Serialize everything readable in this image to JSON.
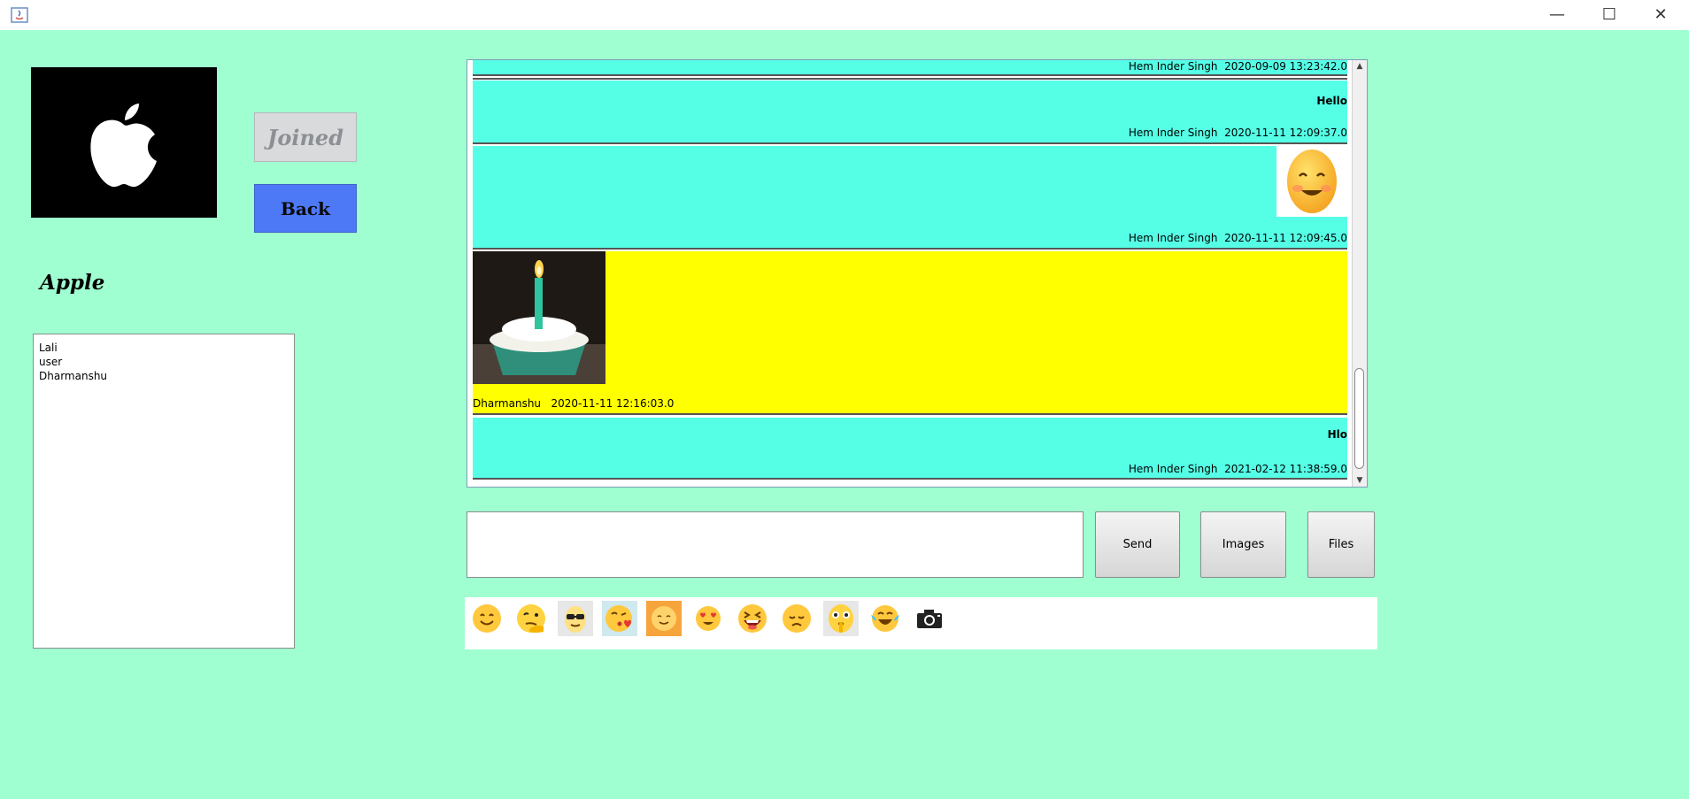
{
  "window": {
    "minimize_glyph": "—",
    "maximize_glyph": "☐",
    "close_glyph": "✕"
  },
  "group": {
    "logo_icon": "apple-logo",
    "joined_label": "Joined",
    "back_label": "Back",
    "name": "Apple",
    "members": [
      "Lali",
      "user",
      "Dharmanshu"
    ]
  },
  "chat": {
    "messages": [
      {
        "sender": "Hem Inder Singh",
        "time": "2020-09-09 13:23:42.0",
        "meta": "Hem Inder Singh  2020-09-09 13:23:42.0",
        "text": "",
        "kind": "text"
      },
      {
        "sender": "Hem Inder Singh",
        "time": "2020-11-11 12:09:37.0",
        "meta": "Hem Inder Singh  2020-11-11 12:09:37.0",
        "text": "Hello",
        "kind": "text"
      },
      {
        "sender": "Hem Inder Singh",
        "time": "2020-11-11 12:09:45.0",
        "meta": "Hem Inder Singh  2020-11-11 12:09:45.0",
        "text": "",
        "kind": "emoji-image"
      },
      {
        "sender": "Dharmanshu",
        "time": "2020-11-11 12:16:03.0",
        "meta": "Dharmanshu   2020-11-11 12:16:03.0",
        "text": "",
        "kind": "photo-cupcake"
      },
      {
        "sender": "Hem Inder Singh",
        "time": "2021-02-12 11:38:59.0",
        "meta": "Hem Inder Singh  2021-02-12 11:38:59.0",
        "text": "Hlo",
        "kind": "text"
      }
    ],
    "colors": {
      "own": "#55ffe6",
      "other": "#ffff00",
      "background": "#9fffd0"
    }
  },
  "composer": {
    "input_value": "",
    "send_label": "Send",
    "images_label": "Images",
    "files_label": "Files"
  },
  "emojis": [
    "smiling-face",
    "thinking-hand-face",
    "sunglasses-face",
    "kissing-heart-face",
    "blushing-face",
    "heart-eyes-face",
    "laughing-squint-face",
    "sad-face",
    "shushing-face",
    "tears-of-joy-face",
    "camera-icon"
  ]
}
